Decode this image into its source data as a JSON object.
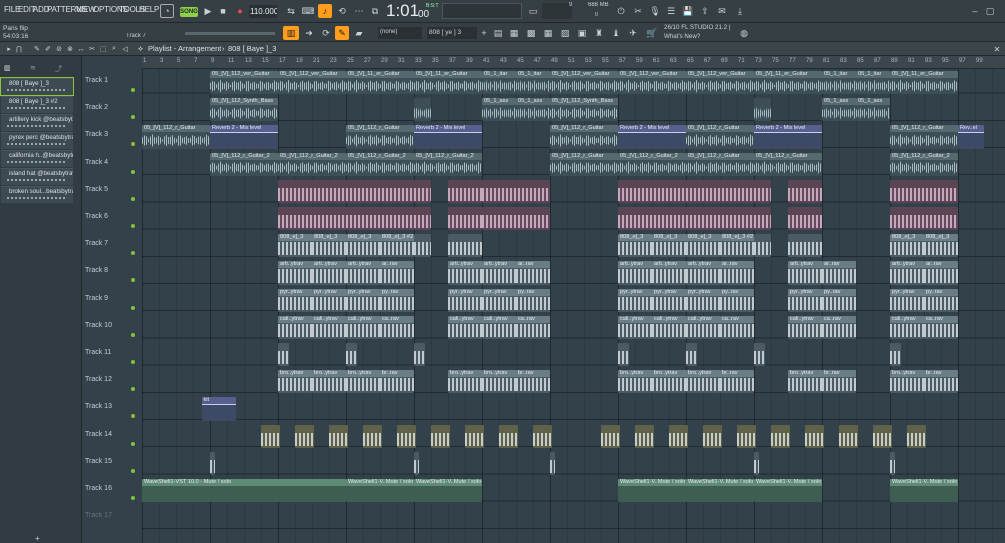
{
  "menu": [
    "FILE",
    "EDIT",
    "ADD",
    "PATTERNS",
    "VIEW",
    "OPTIONS",
    "TOOLS",
    "HELP"
  ],
  "transport": {
    "mode": "SONG",
    "tempo": "110.000",
    "time": "1:01",
    "time_sub": "00",
    "bst": "B:S:T"
  },
  "meters": {
    "cpu": "9",
    "memory": "688 MB",
    "poly": "0"
  },
  "project": {
    "name": "Paris flip",
    "elapsed": "54:03:16",
    "track_hint": "Track 7"
  },
  "news": {
    "line1": "26/10  FL STUDIO 21.2 |",
    "line2": "What's New?"
  },
  "toolbar": {
    "snap": "(none)",
    "pattern": "808 [ ye ] 3"
  },
  "playlist": {
    "breadcrumb": "Playlist - Arrangement",
    "pattern": "808 [ Baye ]_3"
  },
  "browser": {
    "items": [
      "808 [ Baye ]_3",
      "808 [ Baye ]_3 #2",
      "artillery kick @beatsbytrav",
      "pyrex perc @beatsbytrav",
      "california h..@beatsbytrav",
      "island hat @beatsbytrav",
      "broken soul...beatsbytrav"
    ]
  },
  "ruler": [
    "1",
    "3",
    "5",
    "7",
    "9",
    "11",
    "13",
    "15",
    "17",
    "19",
    "21",
    "23",
    "25",
    "27",
    "29",
    "31",
    "33",
    "35",
    "37",
    "39",
    "41",
    "43",
    "45",
    "47",
    "49",
    "51",
    "53",
    "55",
    "57",
    "59",
    "61",
    "63",
    "65",
    "67",
    "69",
    "71",
    "73",
    "75",
    "77",
    "79",
    "81",
    "83",
    "85",
    "87",
    "89",
    "91",
    "93",
    "95",
    "97",
    "99"
  ],
  "tracks": [
    "Track 1",
    "Track 2",
    "Track 3",
    "Track 4",
    "Track 5",
    "Track 6",
    "Track 7",
    "Track 8",
    "Track 9",
    "Track 10",
    "Track 11",
    "Track 12",
    "Track 13",
    "Track 14",
    "Track 15",
    "Track 16",
    "Track 17"
  ],
  "clip_labels": {
    "guitar1": "05_[V]_112_ver_Guitar",
    "guitar1b": "05_[V]_11_er_Guitar",
    "itar": "05_1_itar",
    "bass": "05_[V]_112_Synth_Bass",
    "ass": "05_1_ass",
    "guitar3": "05_[V]_112_r_Guitar",
    "reverb": "Reverb 2 - Mix level",
    "reverbShort": "Rev..el",
    "guitar4": "05_[V]_112_r_Guitar_2",
    "guitar4b": "05_[V]_112_r_Guitar",
    "808": "808_e]_3",
    "808b": "808_e]_3 #2",
    "arti": "arti..ytrav",
    "ar": "ar..rav",
    "pyr": "pyr..ytrav",
    "py": "py..rav",
    "cali": "cali..ytrav",
    "ca": "ca..rav",
    "bro": "bro..ytrav",
    "br": "br..rav",
    "kit": "kit",
    "wave": "WaveShell1-VST 10.0 - Mute / solo",
    "waveShort": "WaveShell1-V..Mute / solo"
  },
  "colors": {
    "accent": "#ff9d1c",
    "led": "#7fc43a",
    "song_button": "#8fd14f"
  }
}
